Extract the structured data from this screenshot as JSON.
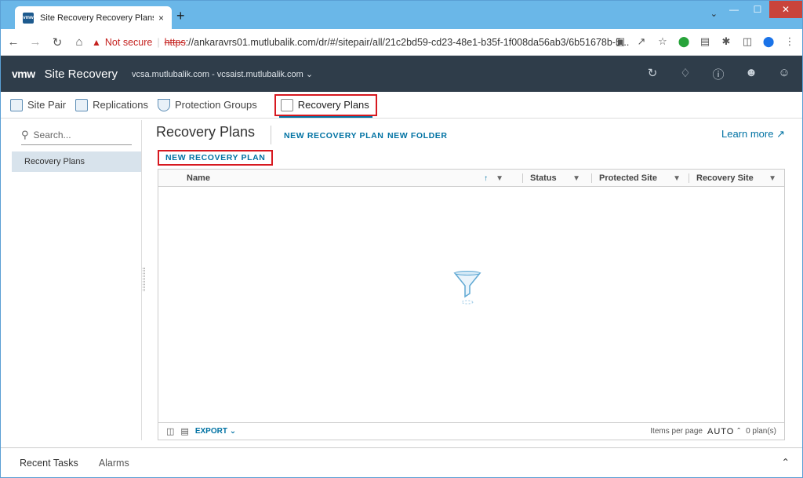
{
  "browser": {
    "tab_title": "Site Recovery Recovery Plans",
    "tab_close": "×",
    "new_tab": "+",
    "url_warning": "Not secure",
    "url_scheme": "https",
    "url_rest": "://ankaravrs01.mutlubalik.com/dr/#/sitepair/all/21c2bd59-cd23-48e1-b35f-1f008da56ab3/6b51678b-5...",
    "favicon_text": "vmw"
  },
  "app": {
    "logo": "vmw",
    "title": "Site Recovery",
    "site_pair": "vcsa.mutlubalik.com - vcsaist.mutlubalik.com"
  },
  "subnav": {
    "site_pair": "Site Pair",
    "replications": "Replications",
    "protection_groups": "Protection Groups",
    "recovery_plans": "Recovery Plans"
  },
  "sidebar": {
    "search_placeholder": "Search...",
    "items": [
      {
        "label": "Recovery Plans"
      }
    ]
  },
  "main": {
    "title": "Recovery Plans",
    "new_recovery_plan": "NEW RECOVERY PLAN",
    "new_folder": "NEW FOLDER",
    "learn_more": "Learn more",
    "new_recovery_plan_button": "NEW RECOVERY PLAN"
  },
  "grid": {
    "columns": [
      {
        "label": "Name"
      },
      {
        "label": "Status"
      },
      {
        "label": "Protected Site"
      },
      {
        "label": "Recovery Site"
      }
    ],
    "export": "EXPORT",
    "items_per_page_label": "Items per page",
    "items_per_page_value": "AUTO",
    "count": "0 plan(s)"
  },
  "bottom": {
    "recent_tasks": "Recent Tasks",
    "alarms": "Alarms"
  },
  "colors": {
    "header_bg": "#2f3d4a",
    "link": "#0072a3",
    "highlight": "#d71920",
    "tabstrip": "#6ab7e8"
  }
}
